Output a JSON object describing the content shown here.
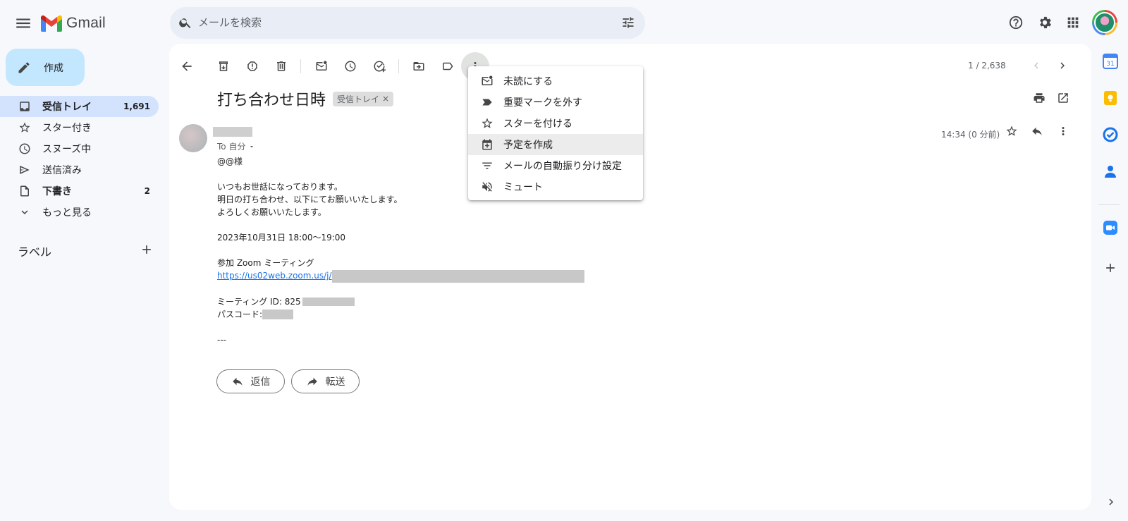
{
  "app": {
    "name": "Gmail"
  },
  "search": {
    "placeholder": "メールを検索"
  },
  "compose": {
    "label": "作成"
  },
  "sidebar": {
    "items": [
      {
        "label": "受信トレイ",
        "count": "1,691"
      },
      {
        "label": "スター付き",
        "count": ""
      },
      {
        "label": "スヌーズ中",
        "count": ""
      },
      {
        "label": "送信済み",
        "count": ""
      },
      {
        "label": "下書き",
        "count": "2"
      },
      {
        "label": "もっと見る",
        "count": ""
      }
    ],
    "labels_title": "ラベル"
  },
  "toolbar": {
    "pager": "1 / 2,638"
  },
  "email": {
    "subject": "打ち合わせ日時",
    "label_chip": "受信トレイ",
    "to": "To 自分",
    "time": "14:34 (0 分前)",
    "greeting": "@@様",
    "line1": "いつもお世話になっております。",
    "line2": "明日の打ち合わせ、以下にてお願いいたします。",
    "line3": "よろしくお願いいたします。",
    "datetime": "2023年10月31日 18:00～19:00",
    "zoom_title": "参加 Zoom ミーティング",
    "zoom_link": "https://us02web.zoom.us/j/",
    "meeting_id": "ミーティング ID: 825",
    "passcode": "パスコード:",
    "signature": "---"
  },
  "actions": {
    "reply": "返信",
    "forward": "転送"
  },
  "menu": {
    "items": [
      {
        "label": "未読にする",
        "icon": "mark-unread-icon"
      },
      {
        "label": "重要マークを外す",
        "icon": "important-icon"
      },
      {
        "label": "スターを付ける",
        "icon": "star-icon"
      },
      {
        "label": "予定を作成",
        "icon": "calendar-add-icon"
      },
      {
        "label": "メールの自動振り分け設定",
        "icon": "filter-icon"
      },
      {
        "label": "ミュート",
        "icon": "mute-icon"
      }
    ],
    "highlighted_index": 3
  },
  "colors": {
    "background": "#f6f8fc",
    "compose": "#c2e7ff",
    "active_nav": "#d3e3fd",
    "link": "#1a73e8"
  }
}
